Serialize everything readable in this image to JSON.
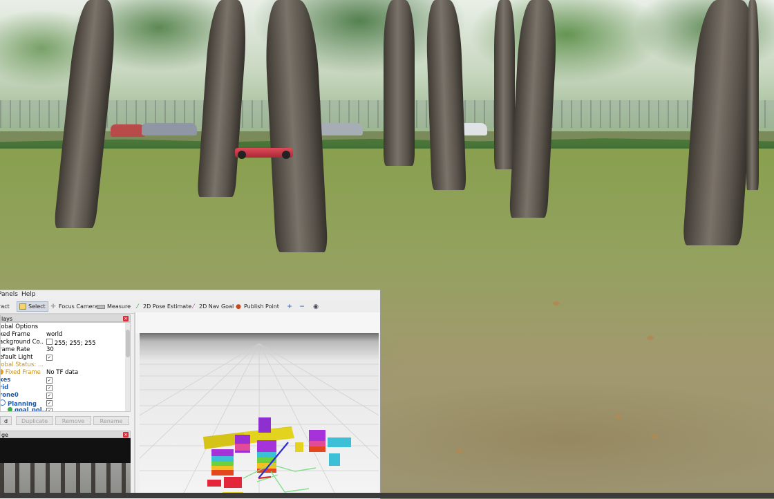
{
  "menu": {
    "panels": "Panels",
    "help": "Help"
  },
  "toolbar": {
    "interact": "ract",
    "select": "Select",
    "focus_camera": "Focus Camera",
    "measure": "Measure",
    "pose_estimate": "2D Pose Estimate",
    "nav_goal": "2D Nav Goal",
    "publish_point": "Publish Point"
  },
  "displays_panel": {
    "title": "lays",
    "rows": [
      {
        "key": "lobal Options",
        "value": ""
      },
      {
        "key": "xed Frame",
        "value": "world"
      },
      {
        "key": "ackground Co...",
        "value": "255; 255; 255"
      },
      {
        "key": "rame Rate",
        "value": "30"
      },
      {
        "key": "efault Light",
        "value": "✓"
      },
      {
        "key": "lobal Status: ...",
        "value": ""
      },
      {
        "key": "Fixed Frame",
        "value": "No TF data"
      },
      {
        "key": "xes",
        "value": "✓"
      },
      {
        "key": "rid",
        "value": "✓"
      },
      {
        "key": "rone0",
        "value": "✓"
      },
      {
        "key": "Planning",
        "value": "✓"
      },
      {
        "key": "goal_pol...",
        "value": "✓"
      }
    ]
  },
  "buttons": {
    "add": "d",
    "duplicate": "Duplicate",
    "remove": "Remove",
    "rename": "Rename"
  },
  "image_panel": {
    "title": "ge"
  },
  "colors": {
    "rviz_bg": "#f0f0f0",
    "link_blue": "#1f59a8",
    "warn": "#c7911a",
    "close_red": "#d8303a"
  }
}
